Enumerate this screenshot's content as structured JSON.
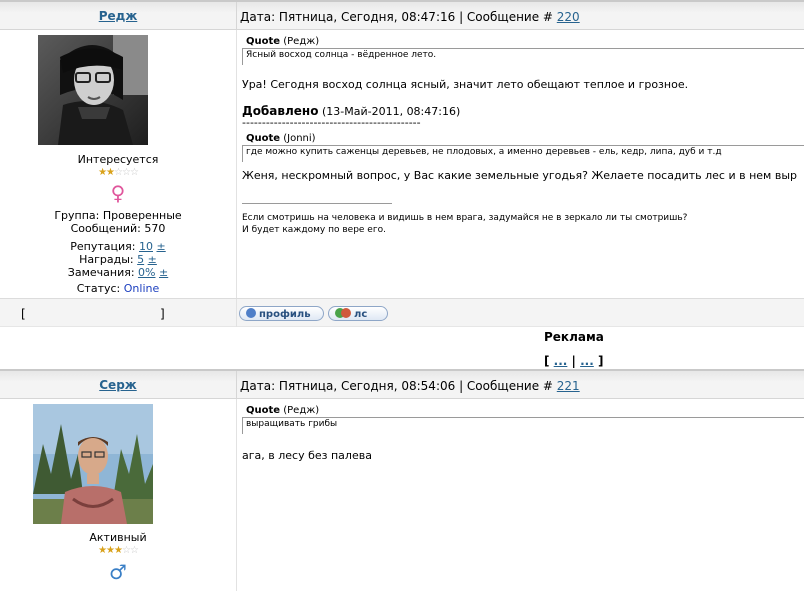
{
  "posts": [
    {
      "author": "Редж",
      "meta_prefix": "Дата: Пятница, Сегодня, 08:47:16 | Сообщение # ",
      "post_number": "220",
      "rank": "Интересуется",
      "stars_filled": 2,
      "stars_total": 5,
      "gender_symbol": "♀",
      "gender_color": "#e0569c",
      "group": "Группа: Проверенные",
      "messages": "Сообщений: 570",
      "reputation_label": "Репутация:",
      "reputation_value": "10",
      "awards_label": "Награды:",
      "awards_value": "5",
      "warnings_label": "Замечания:",
      "warnings_value": "0%",
      "plusminus": "±",
      "status_label": "Статус:",
      "status_value": "Online",
      "quote1_word": "Quote",
      "quote1_author": "(Редж)",
      "quote1_text": "Ясный восход солнца - вёдренное лето.",
      "message1": "Ура! Сегодня восход солнца ясный, значит лето обещают теплое и грозное.",
      "added_label": "Добавлено",
      "added_date": "(13-Май-2011, 08:47:16)",
      "added_rule": "---------------------------------------------",
      "quote2_word": "Quote",
      "quote2_author": "(Jonni)",
      "quote2_text": "где можно купить саженцы деревьев, не плодовых, а именно деревьев - ель, кедр, липа, дуб и т.д",
      "message2": "Женя, нескромный вопрос, у Вас какие земельные угодья? Желаете посадить лес и в нем выр",
      "signature1": "Если смотришь на человека и видишь в нем врага, задумайся не в зеркало ли ты смотришь?",
      "signature2": "И будет каждому по вере его."
    },
    {
      "author": "Серж",
      "meta_prefix": "Дата: Пятница, Сегодня, 08:54:06 | Сообщение # ",
      "post_number": "221",
      "rank": "Активный",
      "stars_filled": 3,
      "stars_total": 5,
      "gender_symbol": "♂",
      "gender_color": "#3a7fc6",
      "quote1_word": "Quote",
      "quote1_author": "(Редж)",
      "quote1_text": "выращивать грибы",
      "message1": "ага, в лесу без палева"
    }
  ],
  "footer": {
    "ip_open": "[",
    "ip_close": "]",
    "profile_button": "профиль",
    "pm_button": "лс"
  },
  "ad": {
    "title": "Реклама",
    "open": "[",
    "link1": "...",
    "sep": "|",
    "link2": "...",
    "close": "]"
  },
  "colors": {
    "link": "#27638f",
    "online": "#1c3fbf",
    "star": "#d9a21b"
  }
}
